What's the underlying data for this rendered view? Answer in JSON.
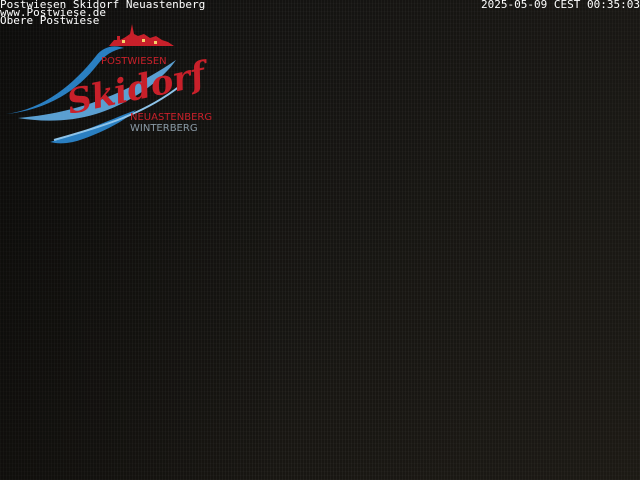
{
  "overlay": {
    "line1": "Postwiesen Skidorf Neuastenberg",
    "line2": "www.Postwiese.de",
    "line3": "Obere Postwiese",
    "timestamp": "2025-05-09 CEST 00:35:03"
  },
  "logo": {
    "top_text": "POSTWIESEN",
    "script_text": "Skidorf",
    "sub_text_1": "NEUASTENBERG",
    "sub_text_2": "WINTERBERG",
    "colors": {
      "red": "#c8202a",
      "blue": "#2a7fc1",
      "gray": "#8a9aa6"
    }
  }
}
